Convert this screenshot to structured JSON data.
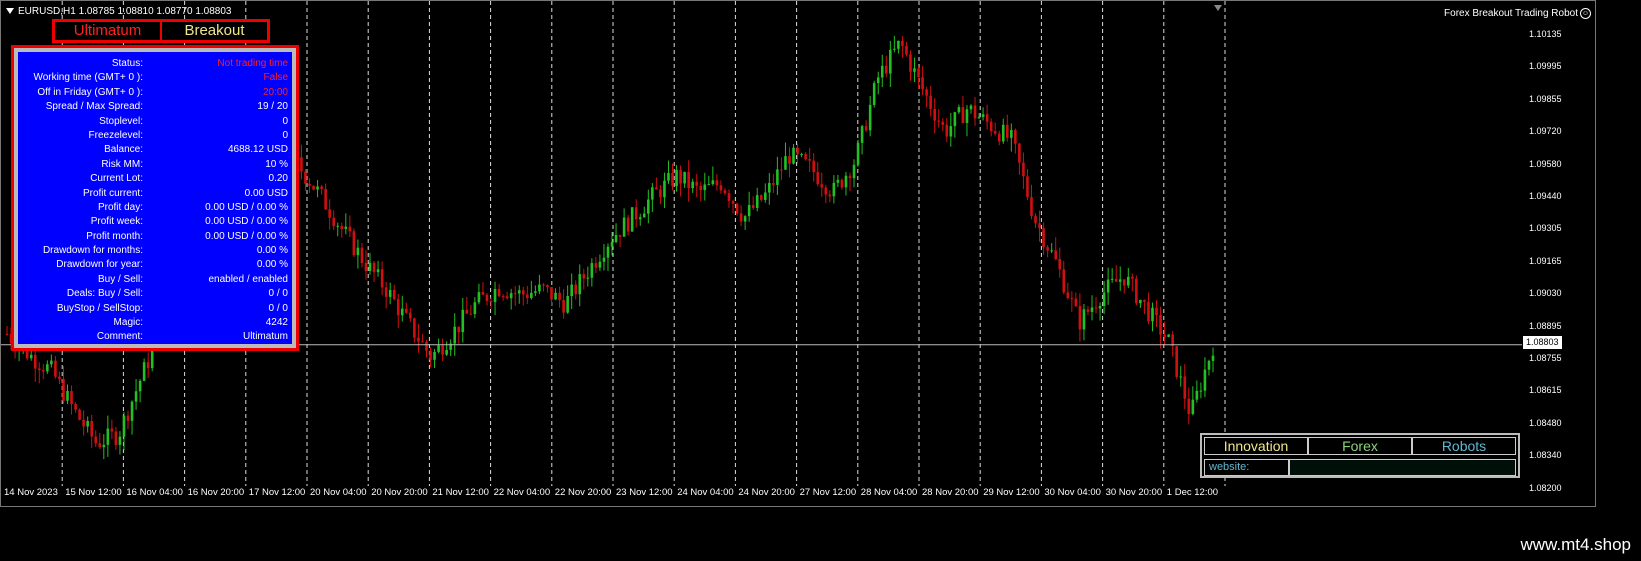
{
  "header": {
    "symbol_line": "EURUSD,H1  1.08785 1.08810 1.08770 1.08803",
    "robot_name": "Forex Breakout Trading Robot",
    "smile_icon": "☺"
  },
  "modes": {
    "left": "Ultimatum",
    "right": "Breakout"
  },
  "panel": {
    "rows": [
      {
        "label": "Status:",
        "value": "Not trading time",
        "red": true
      },
      {
        "label": "Working time (GMT+ 0 ):",
        "value": "False",
        "red": true
      },
      {
        "label": "Off in Friday (GMT+ 0 ):",
        "value": "20:00",
        "red": true
      },
      {
        "label": "Spread / Max Spread:",
        "value": "19 / 20",
        "red": false
      },
      {
        "label": "Stoplevel:",
        "value": "0",
        "red": false
      },
      {
        "label": "Freezelevel:",
        "value": "0",
        "red": false
      },
      {
        "label": "Balance:",
        "value": "4688.12 USD",
        "red": false
      },
      {
        "label": "Risk MM:",
        "value": "10 %",
        "red": false
      },
      {
        "label": "Current Lot:",
        "value": "0.20",
        "red": false
      },
      {
        "label": "Profit current:",
        "value": "0.00 USD",
        "red": false
      },
      {
        "label": "Profit day:",
        "value": "0.00 USD / 0.00 %",
        "red": false
      },
      {
        "label": "Profit week:",
        "value": "0.00 USD / 0.00 %",
        "red": false
      },
      {
        "label": "Profit month:",
        "value": "0.00 USD / 0.00 %",
        "red": false
      },
      {
        "label": "Drawdown for months:",
        "value": "0.00 %",
        "red": false
      },
      {
        "label": "Drawdown for year:",
        "value": "0.00 %",
        "red": false
      },
      {
        "label": "Buy  /  Sell:",
        "value": "enabled  /  enabled",
        "red": false
      },
      {
        "label": "Deals: Buy / Sell:",
        "value": "0  /  0",
        "red": false
      },
      {
        "label": "BuyStop / SellStop:",
        "value": "0  /  0",
        "red": false
      },
      {
        "label": "Magic:",
        "value": "4242",
        "red": false
      },
      {
        "label": "Comment:",
        "value": "Ultimatum",
        "red": false
      }
    ]
  },
  "price_axis": {
    "labels": [
      "1.10135",
      "1.09995",
      "1.09855",
      "1.09720",
      "1.09580",
      "1.09440",
      "1.09305",
      "1.09165",
      "1.09030",
      "1.08895",
      "1.08755",
      "1.08615",
      "1.08480",
      "1.08340",
      "1.08200"
    ],
    "current_price": "1.08803"
  },
  "time_axis": {
    "labels": [
      "14 Nov 2023",
      "15 Nov 12:00",
      "16 Nov 04:00",
      "16 Nov 20:00",
      "17 Nov 12:00",
      "20 Nov 04:00",
      "20 Nov 20:00",
      "21 Nov 12:00",
      "22 Nov 04:00",
      "22 Nov 20:00",
      "23 Nov 12:00",
      "24 Nov 04:00",
      "24 Nov 20:00",
      "27 Nov 12:00",
      "28 Nov 04:00",
      "28 Nov 20:00",
      "29 Nov 12:00",
      "30 Nov 04:00",
      "30 Nov 20:00",
      "1 Dec 12:00"
    ]
  },
  "links_panel": {
    "tabs": [
      "Innovation",
      "Forex",
      "Robots"
    ],
    "website_label": "website:"
  },
  "brand": "www.mt4.shop",
  "colors": {
    "bull": "#22c022",
    "bear": "#d01010",
    "panel_bg": "#0000ff",
    "frame_red": "#ee0000"
  },
  "chart_data": {
    "type": "candlestick",
    "symbol": "EURUSD",
    "timeframe": "H1",
    "ohlc_last": {
      "open": 1.08785,
      "high": 1.0881,
      "low": 1.0877,
      "close": 1.08803
    },
    "ylim": [
      1.082,
      1.10135
    ],
    "grid": "vertical dashed",
    "close_path": [
      1.0885,
      1.0876,
      1.0869,
      1.0852,
      1.0838,
      1.0842,
      1.0866,
      1.0889,
      1.0915,
      1.093,
      1.094,
      1.0955,
      1.0966,
      1.0958,
      1.0945,
      1.093,
      1.0916,
      1.0904,
      1.0889,
      1.0875,
      1.0886,
      1.0898,
      1.0905,
      1.0902,
      1.0904,
      1.0898,
      1.0912,
      1.0926,
      1.0935,
      1.0945,
      1.0953,
      1.0946,
      1.095,
      1.0935,
      1.0945,
      1.0962,
      1.0956,
      1.0946,
      1.096,
      1.0995,
      1.101,
      1.099,
      1.0972,
      1.0982,
      1.0975,
      1.0968,
      1.0935,
      1.0915,
      1.089,
      1.0902,
      1.091,
      1.0896,
      1.0882,
      1.085,
      1.088
    ]
  }
}
